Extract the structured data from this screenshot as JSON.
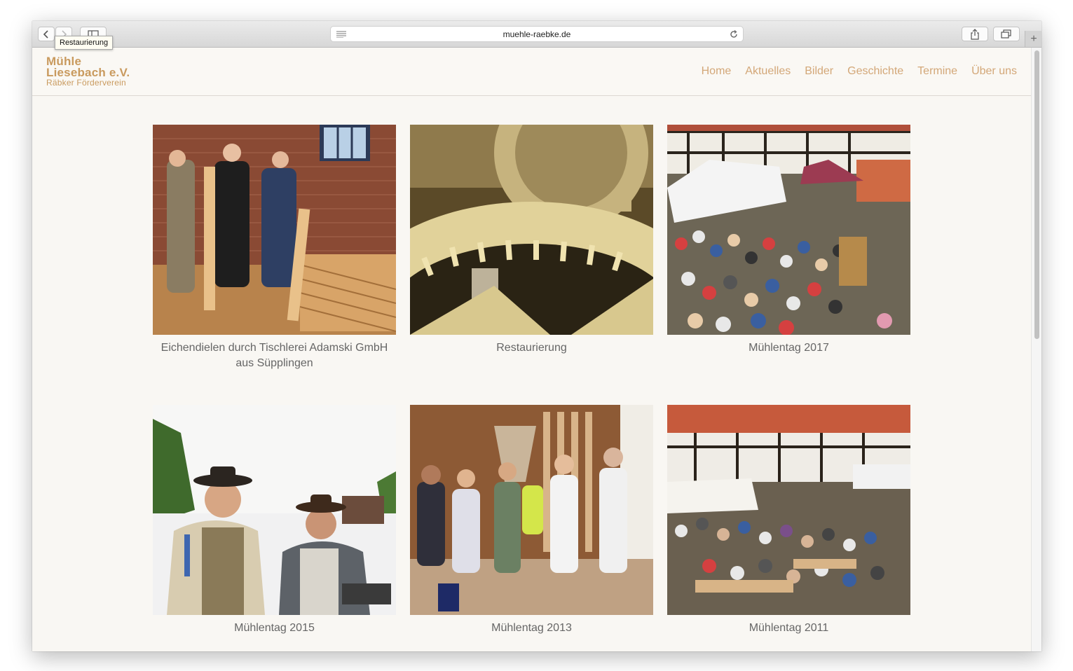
{
  "browser": {
    "url": "muehle-raebke.de",
    "tooltip": "Restaurierung"
  },
  "logo": {
    "line1": "Mühle",
    "line2": "Liesebach e.V.",
    "line3": "Räbker Förderverein"
  },
  "nav": {
    "items": [
      "Home",
      "Aktuelles",
      "Bilder",
      "Geschichte",
      "Termine",
      "Über uns"
    ]
  },
  "gallery": [
    {
      "caption": "Eichendielen durch Tischlerei Adamski GmbH aus Süpplingen"
    },
    {
      "caption": "Restaurierung"
    },
    {
      "caption": "Mühlentag 2017"
    },
    {
      "caption": "Mühlentag 2015"
    },
    {
      "caption": "Mühlentag 2013"
    },
    {
      "caption": "Mühlentag 2011"
    }
  ],
  "colors": {
    "accent": "#d3a778",
    "logo": "#c99a5e",
    "background": "#f9f7f3"
  }
}
